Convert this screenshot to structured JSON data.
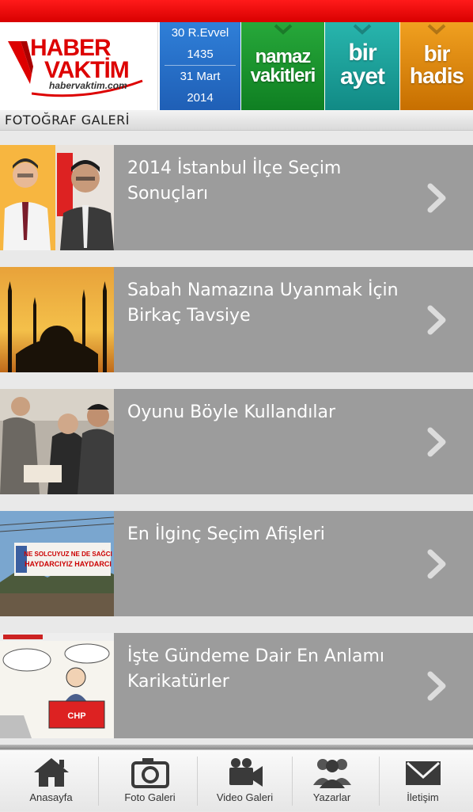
{
  "header": {
    "logo_top": "HABER",
    "logo_bottom": "VAKTİM",
    "logo_url": "habervaktim.com",
    "date": {
      "hijri": "30 R.Evvel",
      "hijri_year": "1435",
      "gregorian": "31 Mart",
      "year": "2014"
    },
    "tiles": [
      {
        "line1": "namaz",
        "line2": "vakitleri"
      },
      {
        "line1": "bir",
        "line2": "ayet"
      },
      {
        "line1": "bir",
        "line2": "hadis"
      }
    ]
  },
  "section_title": "FOTOĞRAF GALERİ",
  "gallery": [
    {
      "title": "2014 İstanbul İlçe Seçim Sonuçları",
      "thumb": "politicians-photo"
    },
    {
      "title": "Sabah Namazına Uyanmak İçin Birkaç Tavsiye",
      "thumb": "mosque-sunset-photo"
    },
    {
      "title": "Oyunu Böyle Kullandılar",
      "thumb": "voting-photo"
    },
    {
      "title": "En İlginç Seçim Afişleri",
      "thumb": "election-banner-photo",
      "banner_line1": "NE SOLCUYUZ NE DE SAĞCI",
      "banner_line2": "HAYDARCIYIZ HAYDARCI"
    },
    {
      "title": "İşte Gündeme Dair En Anlamı Karikatürler",
      "thumb": "cartoon-image",
      "cartoon_label": "CHP"
    }
  ],
  "bottom_nav": [
    {
      "label": "Anasayfa",
      "icon": "home-icon"
    },
    {
      "label": "Foto Galeri",
      "icon": "camera-icon"
    },
    {
      "label": "Video Galeri",
      "icon": "video-camera-icon"
    },
    {
      "label": "Yazarlar",
      "icon": "people-icon"
    },
    {
      "label": "İletişim",
      "icon": "envelope-icon"
    }
  ]
}
